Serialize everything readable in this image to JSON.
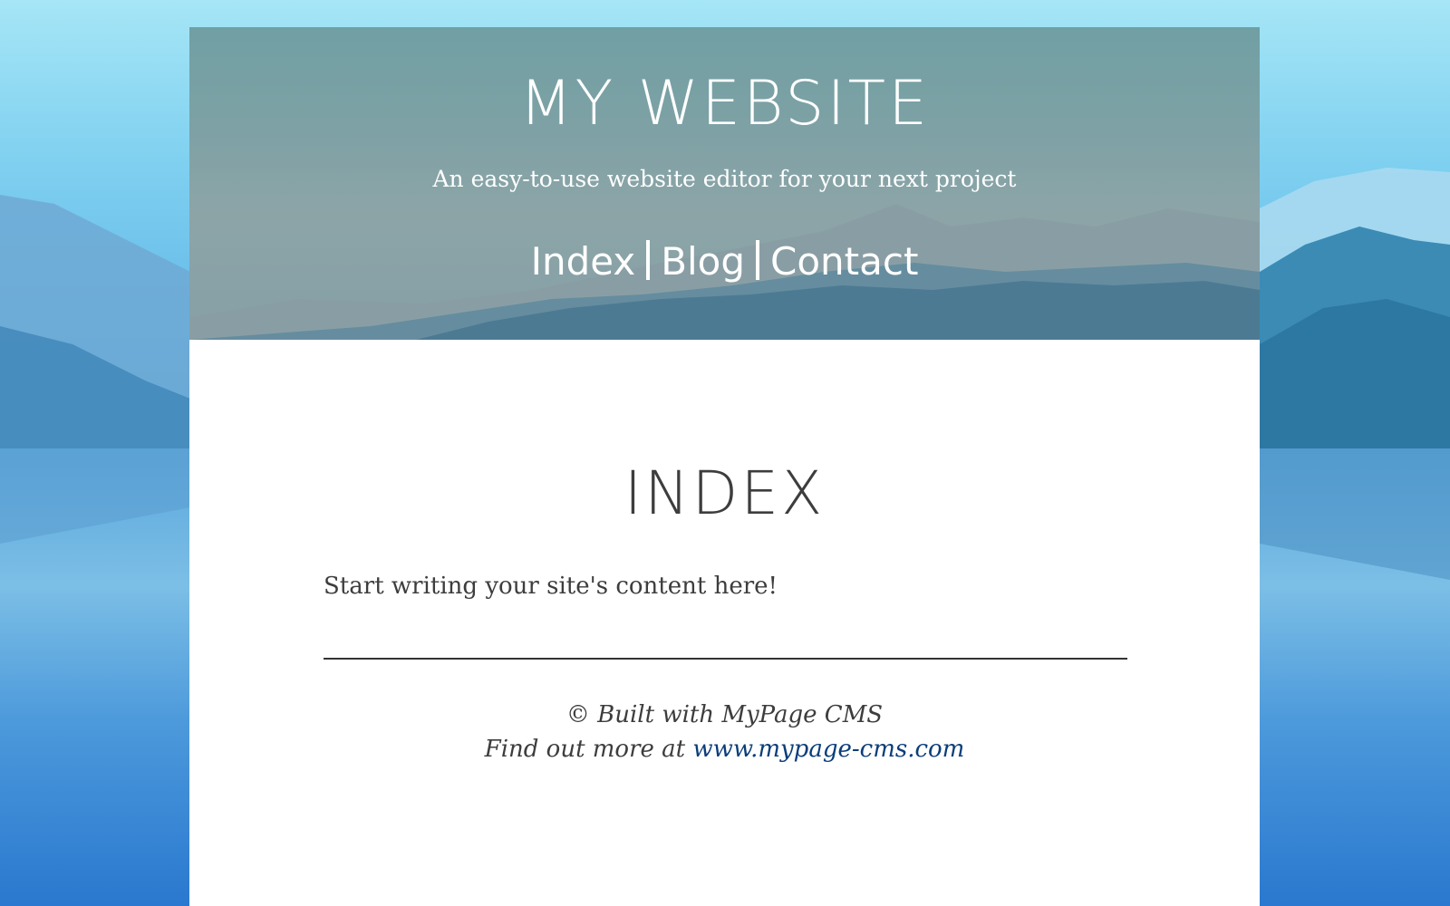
{
  "site": {
    "title": "MY WEBSITE",
    "tagline": "An easy-to-use website editor for your next project"
  },
  "nav": {
    "items": [
      {
        "label": "Index"
      },
      {
        "label": "Blog"
      },
      {
        "label": "Contact"
      }
    ]
  },
  "main": {
    "heading": "INDEX",
    "body": "Start writing your site's content here!"
  },
  "footer": {
    "credit": "© Built with MyPage CMS",
    "more_prefix": "Find out more at",
    "link_text": "www.mypage-cms.com"
  },
  "colors": {
    "text": "#3d3d3d",
    "link": "#0b3d7a",
    "hero_text": "#ffffff",
    "page_bg": "#ffffff"
  },
  "icons": {
    "nav_separator": "vertical-bar"
  }
}
